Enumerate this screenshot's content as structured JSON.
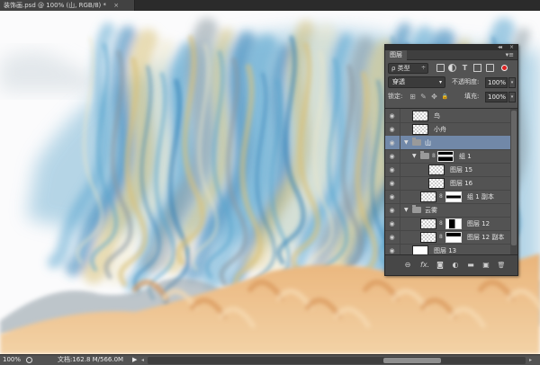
{
  "document": {
    "tab_title": "装饰画.psd @ 100% (山, RGB/8) *",
    "close_glyph": "×"
  },
  "canvas": {
    "colors": {
      "background": "#fbfbfc",
      "sky_blue": "#5aa6cf",
      "deep_blue": "#2f7fb6",
      "ochre": "#d8c27a",
      "cream": "#efe8c9",
      "gray": "#8c9aa3",
      "sand": "#e9b47a",
      "sand_light": "#f3d2a6"
    }
  },
  "layers_panel": {
    "tab_label": "图层",
    "collapse_glyph": "◂◂",
    "close_glyph": "×",
    "menu_glyph": "▾≡",
    "filter": {
      "kind_label": "ρ 类型",
      "kind_dropdown_glyph": "÷",
      "icons": [
        "pixel-filter-icon",
        "adjustment-filter-icon",
        "type-filter-icon",
        "shape-filter-icon",
        "smart-object-filter-icon"
      ],
      "type_glyph": "T"
    },
    "blend_mode": "穿透",
    "opacity_label": "不透明度:",
    "opacity_value": "100%",
    "lock_label": "锁定:",
    "fill_label": "填充:",
    "fill_value": "100%",
    "dropdown_glyph": "▾",
    "lock_glyphs": [
      "⊞",
      "✎",
      "✥",
      "🔒"
    ],
    "eye_glyph": "◉",
    "expand_glyph": "▼",
    "link_glyph": "8",
    "layers": [
      {
        "name": "鸟",
        "type": "pixel",
        "indent": 0,
        "selected": false
      },
      {
        "name": "小舟",
        "type": "pixel",
        "indent": 0,
        "selected": false
      },
      {
        "name": "山",
        "type": "group",
        "indent": 0,
        "selected": true,
        "expanded": true
      },
      {
        "name": "组 1",
        "type": "group",
        "indent": 1,
        "selected": false,
        "expanded": true,
        "has_mask": true
      },
      {
        "name": "图层 15",
        "type": "pixel",
        "indent": 2,
        "selected": false
      },
      {
        "name": "图层 16",
        "type": "pixel",
        "indent": 2,
        "selected": false
      },
      {
        "name": "组 1 副本",
        "type": "pixel-with-mask",
        "indent": 1,
        "selected": false
      },
      {
        "name": "云雾",
        "type": "group",
        "indent": 0,
        "selected": false,
        "expanded": true
      },
      {
        "name": "图层 12",
        "type": "pixel-with-mask",
        "indent": 1,
        "selected": false
      },
      {
        "name": "图层 12 副本",
        "type": "pixel-with-mask",
        "indent": 1,
        "selected": false
      },
      {
        "name": "图层 13",
        "type": "pixel",
        "indent": 0,
        "selected": false,
        "thumb": "white"
      }
    ],
    "footer_icons": [
      "link-layers-icon",
      "fx-icon",
      "add-mask-icon",
      "adjustment-layer-icon",
      "new-group-icon",
      "new-layer-icon",
      "delete-layer-icon"
    ],
    "footer_glyphs": {
      "link": "⊖",
      "fx": "fx.",
      "mask": "◙",
      "adjust": "◐",
      "group": "▬",
      "new": "▣",
      "trash": "🗑"
    }
  },
  "statusbar": {
    "zoom": "100%",
    "doc_info": "文档:162.8 M/566.0M",
    "arrow": "▶",
    "scroll_left": "◂",
    "scroll_right": "▸"
  }
}
